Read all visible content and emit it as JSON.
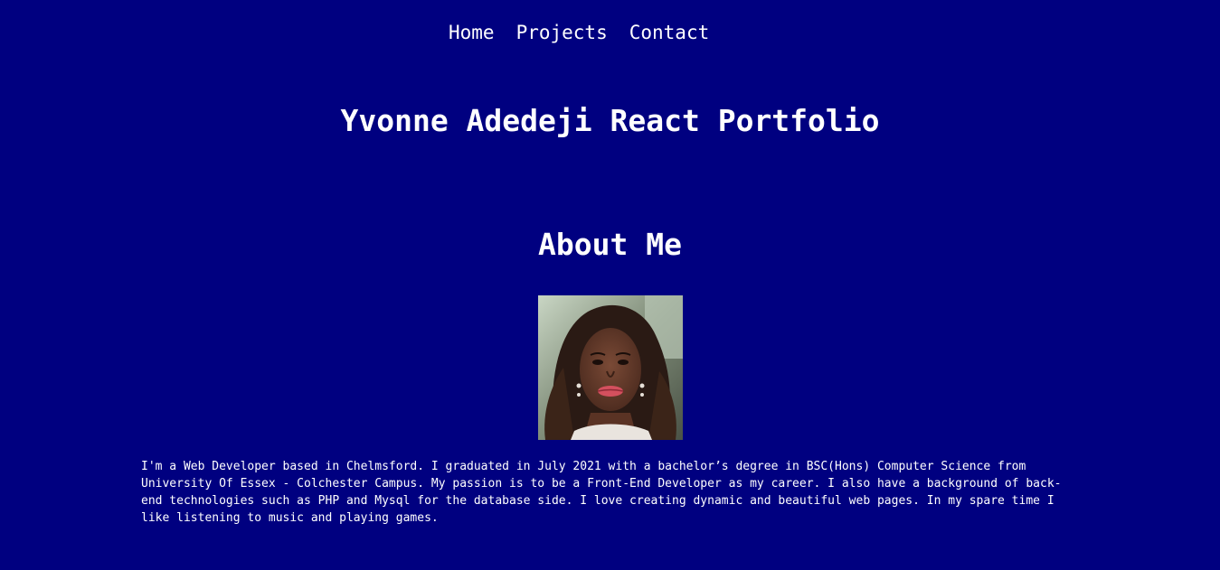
{
  "nav": {
    "items": [
      {
        "label": "Home"
      },
      {
        "label": "Projects"
      },
      {
        "label": "Contact"
      }
    ]
  },
  "header": {
    "title": "Yvonne Adedeji React Portfolio"
  },
  "about": {
    "heading": "About Me",
    "photo_alt": "Yvonne Adedeji profile photo",
    "bio": "I'm a Web Developer based in Chelmsford. I graduated in July 2021 with a bachelor’s degree in BSC(Hons) Computer Science from University Of Essex - Colchester Campus. My passion is to be a Front-End Developer as my career. I also have a background of back-end technologies such as PHP and Mysql for the database side. I love creating dynamic and beautiful web pages. In my spare time I like listening to music and playing games."
  },
  "colors": {
    "background": "#000080",
    "text": "#ffffff"
  }
}
